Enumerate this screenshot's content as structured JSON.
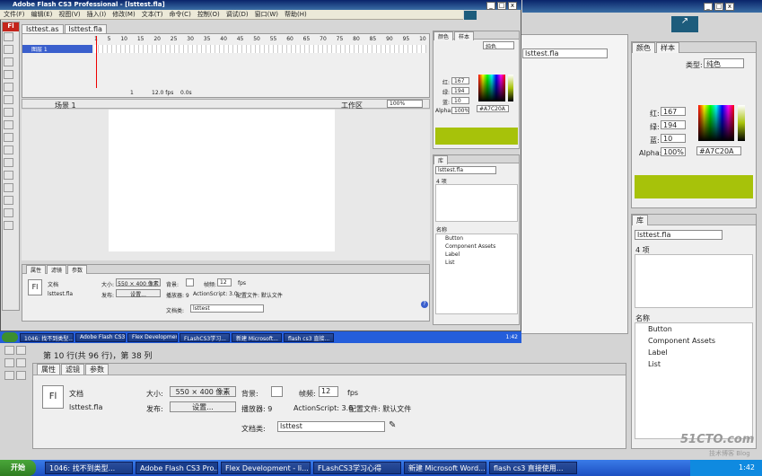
{
  "app": {
    "title": "Adobe Flash CS3 Professional - [lsttest.fla]",
    "logo": "Fl"
  },
  "menu": [
    "文件(F)",
    "编辑(E)",
    "视图(V)",
    "插入(I)",
    "修改(M)",
    "文本(T)",
    "命令(C)",
    "控制(O)",
    "调试(D)",
    "窗口(W)",
    "帮助(H)"
  ],
  "doc_tabs": [
    "lsttest.as",
    "lsttest.fla"
  ],
  "timeline": {
    "layer": "图层 1",
    "frame_marks": [
      "1",
      "5",
      "10",
      "15",
      "20",
      "25",
      "30",
      "35",
      "40",
      "45",
      "50",
      "55",
      "60",
      "65",
      "70",
      "75",
      "80",
      "85",
      "90",
      "95",
      "10"
    ],
    "current_frame": "1",
    "fps": "12.0 fps",
    "time": "0.0s"
  },
  "scene": {
    "name": "场景 1",
    "workspace": "工作区",
    "zoom": "100%"
  },
  "props_small": {
    "tabs": [
      "属性",
      "滤镜",
      "参数"
    ],
    "doc_label": "文档",
    "file": "lsttest.fla",
    "size_label": "大小:",
    "size": "550 × 400 像素",
    "bg_label": "背景:",
    "fps_label": "帧频:",
    "fps": "12",
    "fps_unit": "fps",
    "publish_label": "发布:",
    "settings": "设置...",
    "player_label": "播放器: 9",
    "as_label": "ActionScript: 3.0",
    "profile": "配置文件: 默认文件",
    "class_label": "文档类:",
    "class": "lsttest"
  },
  "color_small": {
    "tabs": [
      "颜色",
      "样本"
    ],
    "r_label": "红:",
    "r": "167",
    "g_label": "绿:",
    "g": "194",
    "b_label": "蓝:",
    "b": "10",
    "alpha_label": "Alpha:",
    "alpha": "100%",
    "hex": "#A7C20A",
    "type": "纯色"
  },
  "library_small": {
    "tab": "库",
    "file": "lsttest.fla",
    "count": "4 项",
    "name_header": "名称",
    "items": [
      "Button",
      "Component Assets",
      "Label",
      "List"
    ]
  },
  "background_window": {
    "file": "lsttest.fla",
    "line_info": "第 10 行(共 96 行)，第 38 列"
  },
  "props_large": {
    "tabs": [
      "属性",
      "滤镜",
      "参数"
    ],
    "doc_label": "文档",
    "file": "lsttest.fla",
    "size_label": "大小:",
    "size": "550 × 400 像素",
    "bg_label": "背景:",
    "fps_label": "帧频:",
    "fps": "12",
    "fps_unit": "fps",
    "publish_label": "发布:",
    "settings": "设置...",
    "player_label": "播放器: 9",
    "as_label": "ActionScript: 3.0",
    "profile": "配置文件: 默认文件",
    "class_label": "文档类:",
    "class": "lsttest"
  },
  "color_large": {
    "tabs": [
      "颜色",
      "样本"
    ],
    "type_label": "类型:",
    "type": "纯色",
    "r_label": "红:",
    "r": "167",
    "g_label": "绿:",
    "g": "194",
    "b_label": "蓝:",
    "b": "10",
    "alpha_label": "Alpha:",
    "alpha": "100%",
    "hex": "#A7C20A"
  },
  "library_large": {
    "tab": "库",
    "file": "lsttest.fla",
    "count": "4 项",
    "name_header": "名称",
    "items": [
      "Button",
      "Component Assets",
      "Label",
      "List"
    ]
  },
  "inner_taskbar": [
    "1046: 找不到类型...",
    "Adobe Flash CS3 ...",
    "Flex Development...",
    "FLashCS3学习...",
    "新建 Microsoft...",
    "flash cs3 直接..."
  ],
  "inner_clock": "1:42",
  "taskbar": {
    "start": "开始",
    "items": [
      "1046: 找不到类型...",
      "Adobe Flash CS3 Pro...",
      "Flex Development - li...",
      "FLashCS3学习心得",
      "新建 Microsoft Word...",
      "flash cs3 直接使用..."
    ],
    "clock": "1:42"
  },
  "watermark": {
    "site": "51CTO.com",
    "sub": "技术博客 Blog"
  },
  "colors": {
    "swatch": "#A7C20A",
    "titlebar": "#0a246a",
    "taskbar": "#245edb"
  }
}
